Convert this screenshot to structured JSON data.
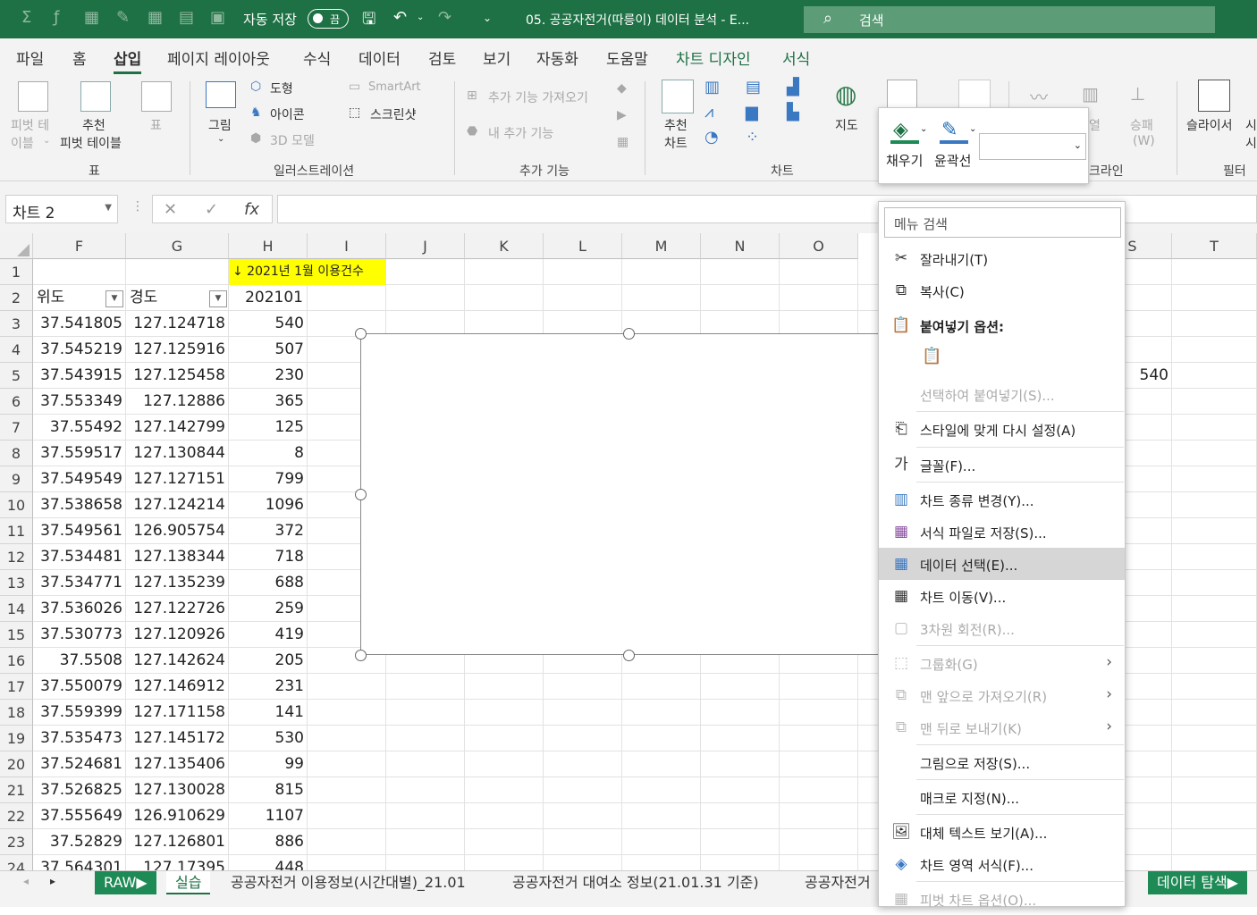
{
  "titlebar": {
    "autosave_label": "자동 저장",
    "autosave_state": "끔",
    "doc_title": "05. 공공자전거(따릉이) 데이터 분석  -  E...",
    "search_placeholder": "검색"
  },
  "menu_tabs": [
    "파일",
    "홈",
    "삽입",
    "페이지 레이아웃",
    "수식",
    "데이터",
    "검토",
    "보기",
    "자동화",
    "도움말",
    "차트 디자인",
    "서식"
  ],
  "ribbon": {
    "pivot_line1": "피벗 테",
    "pivot_line2": "이블",
    "recommended_pivot_line1": "추천",
    "recommended_pivot_line2": "피벗 테이블",
    "table_label": "표",
    "group_table": "표",
    "picture_label": "그림",
    "shapes_label": "도형",
    "icons_label": "아이콘",
    "models3d_label": "3D 모델",
    "smartart_label": "SmartArt",
    "screenshot_label": "스크린샷",
    "group_illustrations": "일러스트레이션",
    "get_addins_label": "추가 기능 가져오기",
    "my_addins_label": "내 추가 기능",
    "group_addins": "추가 기능",
    "rec_charts_line1": "추천",
    "rec_charts_line2": "차트",
    "maps_label": "지도",
    "group_charts": "차트",
    "winloss_line1": "승패",
    "winloss_line2": "(W)",
    "column_partial": "열",
    "group_sparklines_partial": "크라인",
    "slicer_label": "슬라이서",
    "timeline_partial_line1": "시",
    "timeline_partial_line2": "시",
    "group_filter": "필터"
  },
  "formula_bar": {
    "name_box": "차트 2",
    "fx": "fx"
  },
  "columns": [
    "F",
    "G",
    "H",
    "I",
    "J",
    "K",
    "L",
    "M",
    "N",
    "O",
    "S",
    "T"
  ],
  "rows": [
    "1",
    "2",
    "3",
    "4",
    "5",
    "6",
    "7",
    "8",
    "9",
    "10",
    "11",
    "12",
    "13",
    "14",
    "15",
    "16",
    "17",
    "18",
    "19",
    "20",
    "21",
    "22",
    "23",
    "24"
  ],
  "header_note": "↓ 2021년 1월 이용건수",
  "table_headers": {
    "lat": "위도",
    "lng": "경도",
    "count": "202101"
  },
  "table_rows": [
    [
      "37.541805",
      "127.124718",
      "540"
    ],
    [
      "37.545219",
      "127.125916",
      "507"
    ],
    [
      "37.543915",
      "127.125458",
      "230"
    ],
    [
      "37.553349",
      "127.12886",
      "365"
    ],
    [
      "37.55492",
      "127.142799",
      "125"
    ],
    [
      "37.559517",
      "127.130844",
      "8"
    ],
    [
      "37.549549",
      "127.127151",
      "799"
    ],
    [
      "37.538658",
      "127.124214",
      "1096"
    ],
    [
      "37.549561",
      "126.905754",
      "372"
    ],
    [
      "37.534481",
      "127.138344",
      "718"
    ],
    [
      "37.534771",
      "127.135239",
      "688"
    ],
    [
      "37.536026",
      "127.122726",
      "259"
    ],
    [
      "37.530773",
      "127.120926",
      "419"
    ],
    [
      "37.5508",
      "127.142624",
      "205"
    ],
    [
      "37.550079",
      "127.146912",
      "231"
    ],
    [
      "37.559399",
      "127.171158",
      "141"
    ],
    [
      "37.535473",
      "127.145172",
      "530"
    ],
    [
      "37.524681",
      "127.135406",
      "99"
    ],
    [
      "37.526825",
      "127.130028",
      "815"
    ],
    [
      "37.555649",
      "126.910629",
      "1107"
    ],
    [
      "37.52829",
      "127.126801",
      "886"
    ],
    [
      "37.564301",
      "127.17395",
      "448"
    ]
  ],
  "s5_value": "540",
  "minibar": {
    "fill_label": "채우기",
    "outline_label": "윤곽선"
  },
  "context_menu": {
    "search_placeholder": "메뉴 검색",
    "items": [
      {
        "label": "잘라내기(T)",
        "icon": "cut-icon"
      },
      {
        "label": "복사(C)",
        "icon": "copy-icon"
      },
      {
        "label": "붙여넣기 옵션:",
        "icon": "paste-icon"
      },
      {
        "label": "선택하여 붙여넣기(S)...",
        "icon": ""
      },
      {
        "label": "스타일에 맞게 다시 설정(A)",
        "icon": "reset-style-icon"
      },
      {
        "label": "글꼴(F)...",
        "icon": "font-icon"
      },
      {
        "label": "차트 종류 변경(Y)...",
        "icon": "chart-type-icon"
      },
      {
        "label": "서식 파일로 저장(S)...",
        "icon": "save-template-icon"
      },
      {
        "label": "데이터 선택(E)...",
        "icon": "select-data-icon"
      },
      {
        "label": "차트 이동(V)...",
        "icon": "move-chart-icon"
      },
      {
        "label": "3차원 회전(R)...",
        "icon": "rotate-3d-icon"
      },
      {
        "label": "그룹화(G)",
        "icon": "group-icon"
      },
      {
        "label": "맨 앞으로 가져오기(R)",
        "icon": "bring-front-icon"
      },
      {
        "label": "맨 뒤로 보내기(K)",
        "icon": "send-back-icon"
      },
      {
        "label": "그림으로 저장(S)...",
        "icon": ""
      },
      {
        "label": "매크로 지정(N)...",
        "icon": ""
      },
      {
        "label": "대체 텍스트 보기(A)...",
        "icon": "alt-text-icon"
      },
      {
        "label": "차트 영역 서식(F)...",
        "icon": "format-chart-area-icon"
      },
      {
        "label": "피벗 차트 옵션(O)...",
        "icon": "pivot-chart-options-icon"
      }
    ]
  },
  "sheet_tabs": [
    "RAW▶",
    "실습",
    "공공자전거 이용정보(시간대별)_21.01",
    "공공자전거 대여소 정보(21.01.31 기준)",
    "공공자전거",
    "데이터 탐색▶"
  ],
  "colors": {
    "brand_green": "#1e7145",
    "highlight_yellow": "#ffff00",
    "menu_highlight": "#d6d6d6"
  }
}
